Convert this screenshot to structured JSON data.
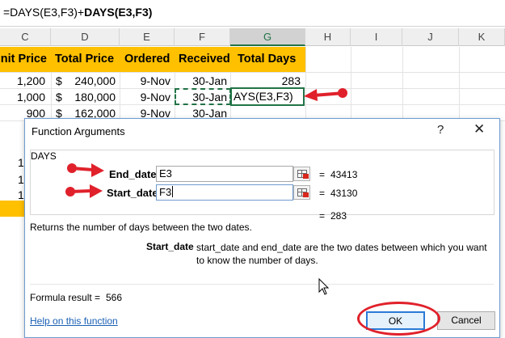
{
  "formula_bar": {
    "plain": "=DAYS(E3,F3)+",
    "bold": "DAYS(E3,F3)"
  },
  "columns": [
    {
      "label": "C",
      "selected": false
    },
    {
      "label": "D",
      "selected": false
    },
    {
      "label": "E",
      "selected": false
    },
    {
      "label": "F",
      "selected": false
    },
    {
      "label": "G",
      "selected": true
    },
    {
      "label": "H",
      "selected": false
    },
    {
      "label": "I",
      "selected": false
    },
    {
      "label": "J",
      "selected": false
    },
    {
      "label": "K",
      "selected": false
    }
  ],
  "table_headers": {
    "unit_price": "nit Price",
    "total_price": "Total Price",
    "ordered": "Ordered",
    "received": "Received",
    "total_days": "Total Days"
  },
  "rows": [
    {
      "unit_price": "1,200",
      "currency": "$",
      "total_price": "240,000",
      "ordered": "9-Nov",
      "received": "30-Jan",
      "total_days": "283"
    },
    {
      "unit_price": "1,000",
      "currency": "$",
      "total_price": "180,000",
      "ordered": "9-Nov",
      "received": "30-Jan",
      "total_days": "AYS(E3,F3)"
    },
    {
      "unit_price": "900",
      "currency": "$",
      "total_price": "162,000",
      "ordered": "9-Nov",
      "received": "30-Jan",
      "total_days": ""
    }
  ],
  "left_partial_values": [
    "1",
    "1",
    "1"
  ],
  "colors": {
    "header_fill": "#ffc000",
    "excel_green": "#217346",
    "annotation_red": "#e0212b",
    "dialog_border": "#6e9bd0"
  },
  "dialog": {
    "title": "Function Arguments",
    "help_glyph": "?",
    "close_glyph": "✕",
    "function_name": "DAYS",
    "args": [
      {
        "label": "End_date",
        "value": "E3",
        "equals": "=",
        "result": "43413"
      },
      {
        "label": "Start_date",
        "value": "F3",
        "equals": "=",
        "result": "43130"
      }
    ],
    "function_result_equals": "=",
    "function_result": "283",
    "description": "Returns the number of days between the two dates.",
    "arg_desc_name": "Start_date",
    "arg_desc_text": "start_date and end_date are the two dates between which you want to know the number of days.",
    "formula_result_label": "Formula result =",
    "formula_result_value": "566",
    "help_link": "Help on this function",
    "ok_label": "OK",
    "cancel_label": "Cancel"
  }
}
